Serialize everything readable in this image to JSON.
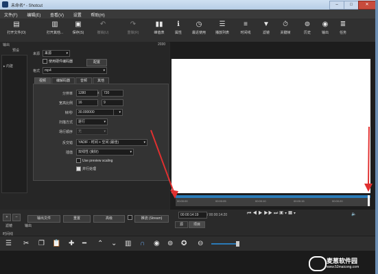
{
  "window": {
    "title": "未命名* - Shotcut"
  },
  "menu": [
    "文件(F)",
    "编辑(E)",
    "查看(V)",
    "设置",
    "帮助(H)"
  ],
  "toolbar": [
    {
      "icon": "folder-open-icon",
      "label": "打开文件(O)"
    },
    {
      "icon": "folder-other-icon",
      "label": "打开其他..."
    },
    {
      "icon": "save-icon",
      "label": "保存(S)"
    },
    {
      "icon": "undo-icon",
      "label": "撤销(U)"
    },
    {
      "icon": "redo-icon",
      "label": "重做(R)"
    },
    {
      "icon": "peak-meter-icon",
      "label": "峰值表"
    },
    {
      "icon": "properties-icon",
      "label": "属性"
    },
    {
      "icon": "recent-icon",
      "label": "最近使用"
    },
    {
      "icon": "playlist-icon",
      "label": "播放列表"
    },
    {
      "icon": "timeline-icon",
      "label": "时间线"
    },
    {
      "icon": "filter-icon",
      "label": "滤镜"
    },
    {
      "icon": "keyframe-icon",
      "label": "关键帧"
    },
    {
      "icon": "history-icon",
      "label": "历史"
    },
    {
      "icon": "export-icon",
      "label": "输出"
    },
    {
      "icon": "jobs-icon",
      "label": "任务"
    }
  ],
  "export_panel": {
    "title": "输出",
    "header_left": "预设",
    "header_right": "2030",
    "from_label": "来源",
    "from_value": "来源",
    "hw_encoder_label": "使用硬件编码器",
    "configure_btn": "配置",
    "format_label": "格式",
    "format_value": "mp4",
    "tabs": [
      "视频",
      "编解码器",
      "音频",
      "其他"
    ],
    "resolution_label": "分辨率",
    "res_w": "1280",
    "res_x": "x",
    "res_h": "720",
    "aspect_label": "宽高比例",
    "aspect_w": "16",
    "aspect_h": "9",
    "fps_label": "帧/秒",
    "fps_value": "30.000000",
    "scan_label": "扫描方式",
    "scan_value": "逐行",
    "field_label": "场行顺序",
    "field_value": "无",
    "deinterlacer_label": "反交错",
    "deinterlacer_value": "YADIF - 时间 + 空间 (最佳)",
    "interp_label": "插值",
    "interp_value": "双线性 (良好)",
    "preview_scaling": "Use preview scaling",
    "parallel": "并行处理",
    "export_btn": "输出文件",
    "reset_btn": "重置",
    "advanced_btn": "高级",
    "stream_btn": "推流 (Stream)",
    "preset_items": [
      "▸ 内建"
    ]
  },
  "viewer": {
    "ticks": [
      "00:00:00",
      "00:00:05",
      "00:00:10",
      "00:00:15",
      "00:00:20"
    ],
    "current_time": "00:00:14:19",
    "total_time": "/ 00:00:14:20",
    "tabs": [
      "源",
      "项目"
    ]
  },
  "bottom_tabs": [
    "滤镜",
    "输出"
  ],
  "timeline": {
    "label": "时间线",
    "icons": [
      "menu-icon",
      "cut-icon",
      "copy-icon",
      "paste-icon",
      "append-icon",
      "remove-icon",
      "lift-icon",
      "overwrite-icon",
      "split-icon",
      "snap-icon",
      "scrub-icon",
      "ripple-icon",
      "ripple-all-icon",
      "zoom-out-icon"
    ]
  },
  "watermark": {
    "text": "麦葱软件园",
    "url": "www.52maicong.com"
  },
  "colors": {
    "accent": "#2a7bb8",
    "annotation_arrow": "#e03030"
  }
}
